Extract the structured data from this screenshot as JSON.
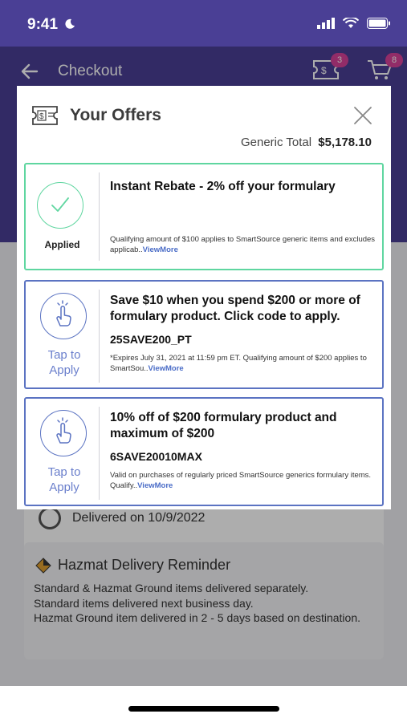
{
  "status": {
    "time": "9:41"
  },
  "nav": {
    "title": "Checkout",
    "coupon_badge": "3",
    "cart_badge": "8"
  },
  "background": {
    "delivered": "Delivered on 10/9/2022",
    "hazmat_title": "Hazmat Delivery Reminder",
    "hazmat_lines": [
      "Standard & Hazmat Ground items delivered separately.",
      "Standard items delivered next business day.",
      "Hazmat Ground item delivered in 2 - 5 days based on destination."
    ]
  },
  "modal": {
    "title": "Your Offers",
    "total_label": "Generic Total",
    "total_value": "$5,178.10",
    "offers": [
      {
        "status": "Applied",
        "title": "Instant Rebate - 2% off your formulary",
        "code": "",
        "fine": "Qualifying amount of $100 applies to SmartSource generic items and excludes applicab..",
        "view_more": "ViewMore"
      },
      {
        "status_line1": "Tap to",
        "status_line2": "Apply",
        "title": "Save $10 when you spend $200 or more of formulary product. Click code to apply.",
        "code": "25SAVE200_PT",
        "fine": "*Expires July 31, 2021 at 11:59 pm ET. Qualifying amount of $200 applies to SmartSou..",
        "view_more": "ViewMore"
      },
      {
        "status_line1": "Tap to",
        "status_line2": "Apply",
        "title": "10% off of $200 formulary product and maximum of $200",
        "code": "6SAVE20010MAX",
        "fine": "Valid on purchases of regularly priced SmartSource generics formulary items. Qualify..",
        "view_more": "ViewMore"
      }
    ]
  },
  "colors": {
    "brand_purple": "#4a3f95",
    "applied_green": "#5fd6a0",
    "offer_blue": "#5b73c2",
    "badge_pink": "#d8419a"
  }
}
